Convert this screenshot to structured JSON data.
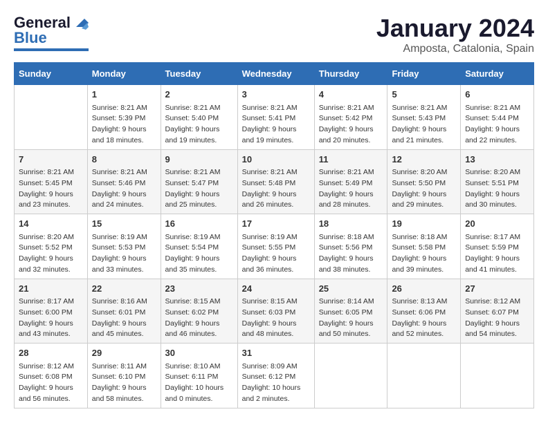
{
  "header": {
    "logo_general": "General",
    "logo_blue": "Blue",
    "title": "January 2024",
    "subtitle": "Amposta, Catalonia, Spain"
  },
  "days_of_week": [
    "Sunday",
    "Monday",
    "Tuesday",
    "Wednesday",
    "Thursday",
    "Friday",
    "Saturday"
  ],
  "weeks": [
    [
      {
        "day": "",
        "info": ""
      },
      {
        "day": "1",
        "info": "Sunrise: 8:21 AM\nSunset: 5:39 PM\nDaylight: 9 hours\nand 18 minutes."
      },
      {
        "day": "2",
        "info": "Sunrise: 8:21 AM\nSunset: 5:40 PM\nDaylight: 9 hours\nand 19 minutes."
      },
      {
        "day": "3",
        "info": "Sunrise: 8:21 AM\nSunset: 5:41 PM\nDaylight: 9 hours\nand 19 minutes."
      },
      {
        "day": "4",
        "info": "Sunrise: 8:21 AM\nSunset: 5:42 PM\nDaylight: 9 hours\nand 20 minutes."
      },
      {
        "day": "5",
        "info": "Sunrise: 8:21 AM\nSunset: 5:43 PM\nDaylight: 9 hours\nand 21 minutes."
      },
      {
        "day": "6",
        "info": "Sunrise: 8:21 AM\nSunset: 5:44 PM\nDaylight: 9 hours\nand 22 minutes."
      }
    ],
    [
      {
        "day": "7",
        "info": "Sunrise: 8:21 AM\nSunset: 5:45 PM\nDaylight: 9 hours\nand 23 minutes."
      },
      {
        "day": "8",
        "info": "Sunrise: 8:21 AM\nSunset: 5:46 PM\nDaylight: 9 hours\nand 24 minutes."
      },
      {
        "day": "9",
        "info": "Sunrise: 8:21 AM\nSunset: 5:47 PM\nDaylight: 9 hours\nand 25 minutes."
      },
      {
        "day": "10",
        "info": "Sunrise: 8:21 AM\nSunset: 5:48 PM\nDaylight: 9 hours\nand 26 minutes."
      },
      {
        "day": "11",
        "info": "Sunrise: 8:21 AM\nSunset: 5:49 PM\nDaylight: 9 hours\nand 28 minutes."
      },
      {
        "day": "12",
        "info": "Sunrise: 8:20 AM\nSunset: 5:50 PM\nDaylight: 9 hours\nand 29 minutes."
      },
      {
        "day": "13",
        "info": "Sunrise: 8:20 AM\nSunset: 5:51 PM\nDaylight: 9 hours\nand 30 minutes."
      }
    ],
    [
      {
        "day": "14",
        "info": "Sunrise: 8:20 AM\nSunset: 5:52 PM\nDaylight: 9 hours\nand 32 minutes."
      },
      {
        "day": "15",
        "info": "Sunrise: 8:19 AM\nSunset: 5:53 PM\nDaylight: 9 hours\nand 33 minutes."
      },
      {
        "day": "16",
        "info": "Sunrise: 8:19 AM\nSunset: 5:54 PM\nDaylight: 9 hours\nand 35 minutes."
      },
      {
        "day": "17",
        "info": "Sunrise: 8:19 AM\nSunset: 5:55 PM\nDaylight: 9 hours\nand 36 minutes."
      },
      {
        "day": "18",
        "info": "Sunrise: 8:18 AM\nSunset: 5:56 PM\nDaylight: 9 hours\nand 38 minutes."
      },
      {
        "day": "19",
        "info": "Sunrise: 8:18 AM\nSunset: 5:58 PM\nDaylight: 9 hours\nand 39 minutes."
      },
      {
        "day": "20",
        "info": "Sunrise: 8:17 AM\nSunset: 5:59 PM\nDaylight: 9 hours\nand 41 minutes."
      }
    ],
    [
      {
        "day": "21",
        "info": "Sunrise: 8:17 AM\nSunset: 6:00 PM\nDaylight: 9 hours\nand 43 minutes."
      },
      {
        "day": "22",
        "info": "Sunrise: 8:16 AM\nSunset: 6:01 PM\nDaylight: 9 hours\nand 45 minutes."
      },
      {
        "day": "23",
        "info": "Sunrise: 8:15 AM\nSunset: 6:02 PM\nDaylight: 9 hours\nand 46 minutes."
      },
      {
        "day": "24",
        "info": "Sunrise: 8:15 AM\nSunset: 6:03 PM\nDaylight: 9 hours\nand 48 minutes."
      },
      {
        "day": "25",
        "info": "Sunrise: 8:14 AM\nSunset: 6:05 PM\nDaylight: 9 hours\nand 50 minutes."
      },
      {
        "day": "26",
        "info": "Sunrise: 8:13 AM\nSunset: 6:06 PM\nDaylight: 9 hours\nand 52 minutes."
      },
      {
        "day": "27",
        "info": "Sunrise: 8:12 AM\nSunset: 6:07 PM\nDaylight: 9 hours\nand 54 minutes."
      }
    ],
    [
      {
        "day": "28",
        "info": "Sunrise: 8:12 AM\nSunset: 6:08 PM\nDaylight: 9 hours\nand 56 minutes."
      },
      {
        "day": "29",
        "info": "Sunrise: 8:11 AM\nSunset: 6:10 PM\nDaylight: 9 hours\nand 58 minutes."
      },
      {
        "day": "30",
        "info": "Sunrise: 8:10 AM\nSunset: 6:11 PM\nDaylight: 10 hours\nand 0 minutes."
      },
      {
        "day": "31",
        "info": "Sunrise: 8:09 AM\nSunset: 6:12 PM\nDaylight: 10 hours\nand 2 minutes."
      },
      {
        "day": "",
        "info": ""
      },
      {
        "day": "",
        "info": ""
      },
      {
        "day": "",
        "info": ""
      }
    ]
  ]
}
